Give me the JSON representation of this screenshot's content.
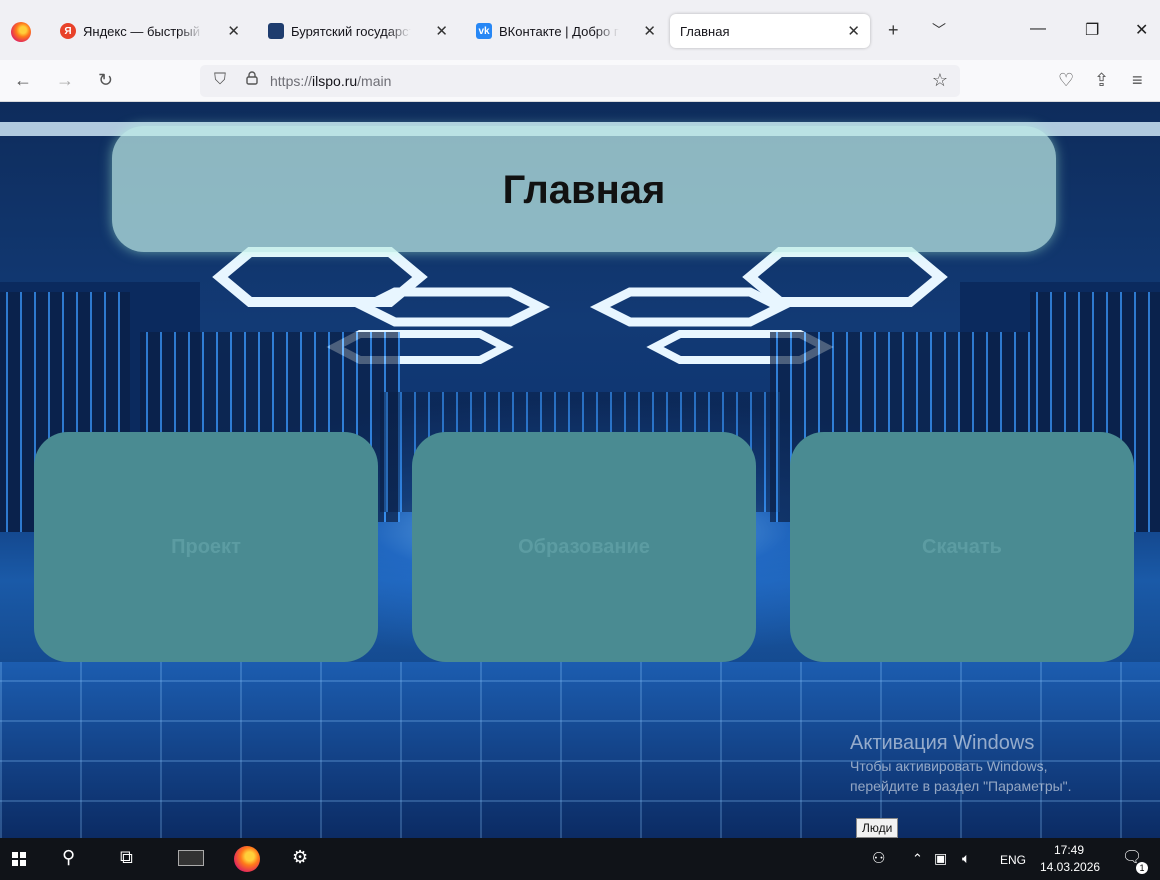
{
  "browser": {
    "tabs": [
      {
        "title": "Яндекс — быстрый п",
        "favicon": "yandex-icon",
        "color": "#e8422a"
      },
      {
        "title": "Бурятский государстве",
        "favicon": "bgu-icon",
        "color": "#1e3c6e"
      },
      {
        "title": "ВКонтакте | Добро пож",
        "favicon": "vk-icon",
        "color": "#2787f5"
      },
      {
        "title": "Главная",
        "favicon": "",
        "color": ""
      }
    ],
    "new_tab_label": "+",
    "url_prefix": "https://",
    "url_domain": "ilspo.ru",
    "url_path": "/main"
  },
  "page": {
    "title": "Главная",
    "cards": [
      {
        "label": "Проект"
      },
      {
        "label": "Образование"
      },
      {
        "label": "Скачать"
      }
    ],
    "card_color": "#4a8b92"
  },
  "windows": {
    "activation_title": "Активация Windows",
    "activation_line1": "Чтобы активировать Windows,",
    "activation_line2": "перейдите в раздел \"Параметры\".",
    "tooltip": "Люди",
    "lang": "ENG",
    "time": "17:49",
    "date": "14.03.2026",
    "notification_count": "1"
  }
}
